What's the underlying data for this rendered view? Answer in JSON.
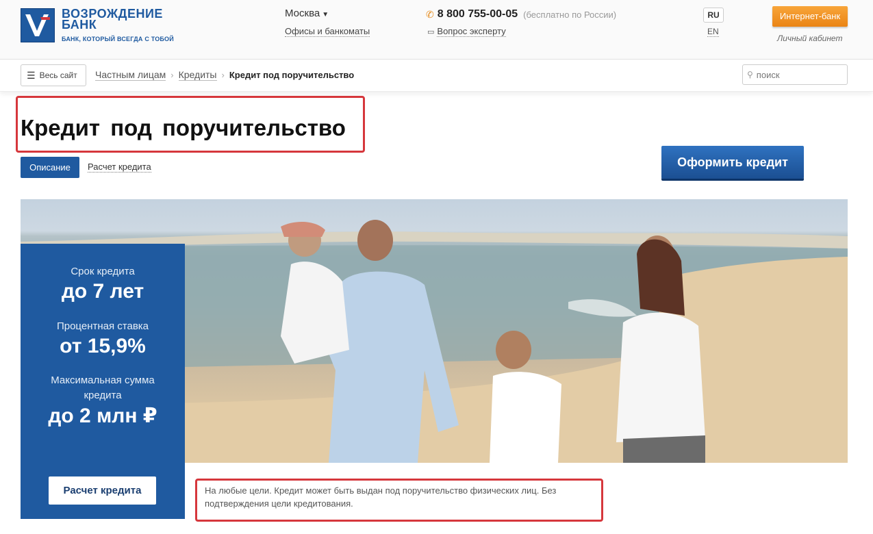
{
  "header": {
    "logo_name_line1": "ВОЗРОЖДЕНИЕ",
    "logo_name_line2": "БАНК",
    "logo_tagline": "БАНК, КОТОРЫЙ ВСЕГДА С ТОБОЙ",
    "city": "Москва",
    "offices_link": "Офисы и банкоматы",
    "phone": "8 800 755-00-05",
    "phone_note": "(бесплатно по России)",
    "expert_link": "Вопрос эксперту",
    "lang_ru": "RU",
    "lang_en": "EN",
    "internet_bank_button": "Интернет-банк",
    "cabinet_label": "Личный кабинет"
  },
  "breadcrumb": {
    "all_site_button": "Весь сайт",
    "items": [
      "Частным лицам",
      "Кредиты"
    ],
    "current": "Кредит под поручительство"
  },
  "search": {
    "placeholder": "поиск"
  },
  "page": {
    "title": "Кредит под поручительство",
    "tabs": [
      {
        "label": "Описание",
        "active": true
      },
      {
        "label": "Расчет кредита",
        "active": false
      }
    ],
    "apply_button": "Оформить кредит"
  },
  "offer": {
    "term_label": "Срок кредита",
    "term_value": "до 7 лет",
    "rate_label": "Процентная ставка",
    "rate_value": "от 15,9%",
    "amount_label_line1": "Максимальная сумма",
    "amount_label_line2": "кредита",
    "amount_value": "до 2 млн ₽",
    "calc_button": "Расчет кредита",
    "description": "На любые цели. Кредит может быть выдан под поручительство физических лиц. Без подтверждения цели кредитования."
  },
  "colors": {
    "brand_blue": "#1f5aa0",
    "accent_orange": "#ea8415",
    "highlight_red": "#d6373c"
  },
  "icons": {
    "phone": "phone-icon",
    "chat": "chat-icon",
    "menu": "menu-icon",
    "search": "search-icon",
    "caret": "caret-down-icon"
  }
}
